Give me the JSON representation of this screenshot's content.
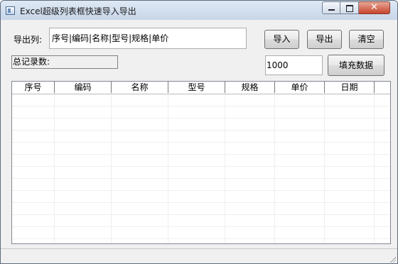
{
  "window": {
    "title": "Excel超级列表框快速导入导出",
    "controls": {
      "minimize": "minimize-icon",
      "maximize": "maximize-icon",
      "close": "✕"
    }
  },
  "export": {
    "label": "导出列:",
    "columns_value": "序号|编码|名称|型号|规格|单价"
  },
  "buttons": {
    "import": "导入",
    "export": "导出",
    "clear": "清空",
    "fill": "填充数据"
  },
  "total": {
    "label": "总记录数:"
  },
  "fill_count": "1000",
  "table": {
    "columns": [
      "序号",
      "编码",
      "名称",
      "型号",
      "规格",
      "单价",
      "日期"
    ],
    "rows": []
  },
  "colors": {
    "window_bg": "#f0f0f0",
    "titlebar": "#c7d6e8",
    "close_button": "#c7432b"
  }
}
